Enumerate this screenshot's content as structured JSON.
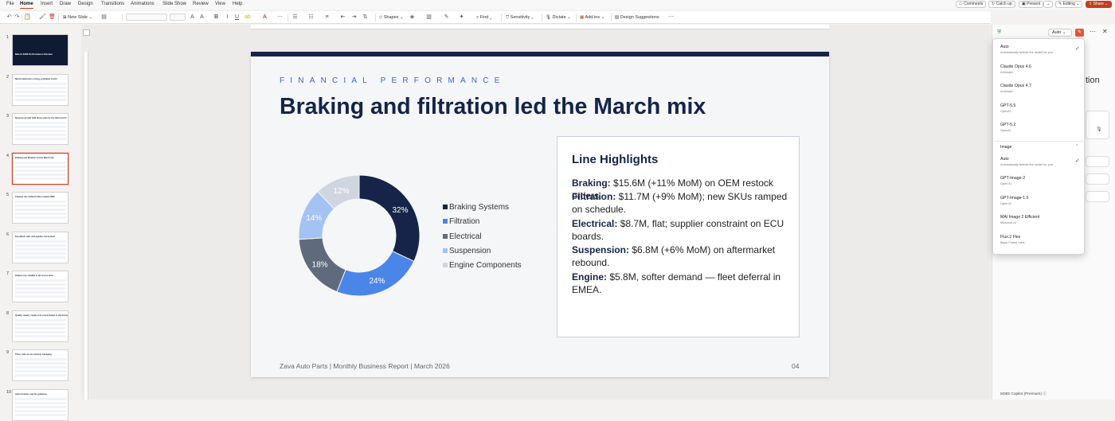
{
  "menu": {
    "items": [
      "File",
      "Home",
      "Insert",
      "Draw",
      "Design",
      "Transitions",
      "Animations",
      "Slide Show",
      "Review",
      "View",
      "Help"
    ],
    "active": "Home",
    "comments": "Comments",
    "catch_up": "Catch up",
    "present": "Present",
    "editing": "Editing",
    "share": "Share"
  },
  "ribbon": {
    "new_slide": "New Slide",
    "shapes": "Shapes",
    "find": "Find",
    "sensitivity": "Sensitivity",
    "dictate": "Dictate",
    "add_ins": "Add-ins",
    "design_suggestions": "Design Suggestions"
  },
  "thumbnails": [
    {
      "num": "1",
      "title": "March 2026 Performance Review",
      "dark": true
    },
    {
      "num": "2",
      "title": "March delivered a strong, profitable month",
      "dark": false
    },
    {
      "num": "3",
      "title": "Revenue growth held above plan for the third month",
      "dark": false
    },
    {
      "num": "4",
      "title": "Braking and filtration led the March mix",
      "dark": false,
      "selected": true
    },
    {
      "num": "5",
      "title": "Channel mix shifted further toward OEM",
      "dark": false
    },
    {
      "num": "6",
      "title": "Key March wins and pipeline momentum",
      "dark": false
    },
    {
      "num": "7",
      "title": "Output rose steadily in Q1 across lines",
      "dark": false
    },
    {
      "num": "8",
      "title": "Quality steady; supply risk concentrated in electronics",
      "dark": false
    },
    {
      "num": "9",
      "title": "Three risks we are actively managing",
      "dark": false
    },
    {
      "num": "10",
      "title": "April priorities and the guidance",
      "dark": false
    }
  ],
  "slide": {
    "eyebrow": "FINANCIAL PERFORMANCE",
    "title": "Braking and filtration led the March mix",
    "highlights_title": "Line Highlights",
    "highlights": [
      {
        "label": "Braking:",
        "text": " $15.6M (+11% MoM) on OEM restock orders."
      },
      {
        "label": "Filtration:",
        "text": " $11.7M (+9% MoM); new SKUs ramped on schedule."
      },
      {
        "label": "Electrical:",
        "text": " $8.7M, flat; supplier constraint on ECU boards."
      },
      {
        "label": "Suspension:",
        "text": " $6.8M (+6% MoM) on aftermarket rebound."
      },
      {
        "label": "Engine:",
        "text": " $5.8M, softer demand — fleet deferral in EMEA."
      }
    ],
    "footer": "Zava Auto Parts | Monthly Business Report | March 2026",
    "page": "04"
  },
  "chart_data": {
    "type": "pie",
    "donut": true,
    "categories": [
      "Braking Systems",
      "Filtration",
      "Electrical",
      "Suspension",
      "Engine Components"
    ],
    "values": [
      32,
      24,
      18,
      14,
      12
    ],
    "labels": [
      "32%",
      "24%",
      "18%",
      "14%",
      "12%"
    ],
    "colors": [
      "#152448",
      "#4a86e8",
      "#5f6b7d",
      "#a4c2f4",
      "#cfd6e0"
    ],
    "label_colors": [
      "#ffffff",
      "#ffffff",
      "#ffffff",
      "#ffffff",
      "#ffffff"
    ],
    "legend_position": "right"
  },
  "copilot": {
    "model_button": "Auto",
    "footer": "M365 Copilot (Premium)",
    "sections": [
      {
        "name": "",
        "options": [
          {
            "title": "Auto",
            "sub": "Automatically selects the model for you",
            "checked": true
          },
          {
            "title": "Claude Opus 4.6",
            "sub": "Anthropic"
          },
          {
            "title": "Claude Opus 4.7",
            "sub": "Anthropic"
          },
          {
            "title": "GPT-5.5",
            "sub": "OpenAI"
          },
          {
            "title": "GPT-5.2",
            "sub": "OpenAI"
          }
        ]
      },
      {
        "name": "Image",
        "options": [
          {
            "title": "Auto",
            "sub": "Automatically selects the model for you",
            "checked": true
          },
          {
            "title": "GPT-Image-2",
            "sub": "Open AI"
          },
          {
            "title": "GPT-Image-1.5",
            "sub": "Open AI"
          },
          {
            "title": "MAI Image 2 Efficient",
            "sub": "Microsoft AI"
          },
          {
            "title": "Flux.2 Flex",
            "sub": "Black Forest Labs"
          }
        ]
      }
    ],
    "background_heading_fragment": "tion"
  }
}
